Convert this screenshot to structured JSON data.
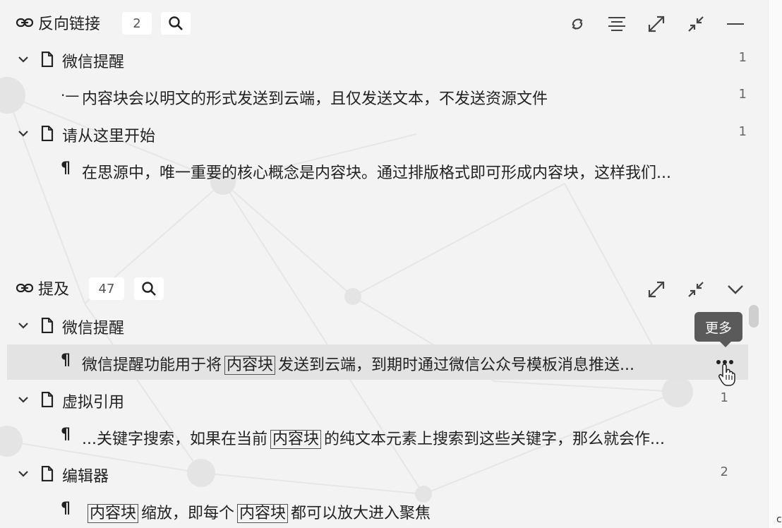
{
  "backlinks": {
    "title": "反向链接",
    "count": "2",
    "tools": [
      "refresh-icon",
      "align-center-icon",
      "expand-icon",
      "collapse-icon",
      "minimize-icon"
    ],
    "groups": [
      {
        "doc": "微信提醒",
        "count": "1",
        "items": [
          {
            "marker": "·—",
            "text": "内容块会以明文的形式发送到云端，且仅发送文本，不发送资源文件",
            "count": "1"
          }
        ]
      },
      {
        "doc": "请从这里开始",
        "count": "1",
        "items": [
          {
            "marker": "¶",
            "text": "在思源中，唯一重要的核心概念是内容块。通过排版格式即可形成内容块，这样我们..."
          }
        ]
      }
    ]
  },
  "mentions": {
    "title": "提及",
    "count": "47",
    "tools": [
      "expand-icon",
      "collapse-icon",
      "chevron-down-icon"
    ],
    "groups": [
      {
        "doc": "微信提醒",
        "items": [
          {
            "marker": "¶",
            "pre": "微信提醒功能用于将",
            "hl": "内容块",
            "post": "发送到云端，到期时通过微信公众号模板消息推送..."
          }
        ]
      },
      {
        "doc": "虚拟引用",
        "count": "1",
        "items": [
          {
            "marker": "¶",
            "pre": "...关键字搜索，如果在当前",
            "hl": "内容块",
            "post": "的纯文本元素上搜索到这些关键字，那么就会作..."
          }
        ]
      },
      {
        "doc": "编辑器",
        "count": "2",
        "items": [
          {
            "marker": "¶",
            "pre": "",
            "hl": "内容块",
            "post": "缩放，即每个",
            "hl2": "内容块",
            "post2": "都可以放大进入聚焦"
          }
        ]
      }
    ]
  },
  "tooltip": {
    "text": "更多"
  },
  "colors": {
    "panel_bg": "#f3f3f3",
    "selected_row": "#e3e3e3",
    "tooltip_bg": "#5a5a5a"
  }
}
